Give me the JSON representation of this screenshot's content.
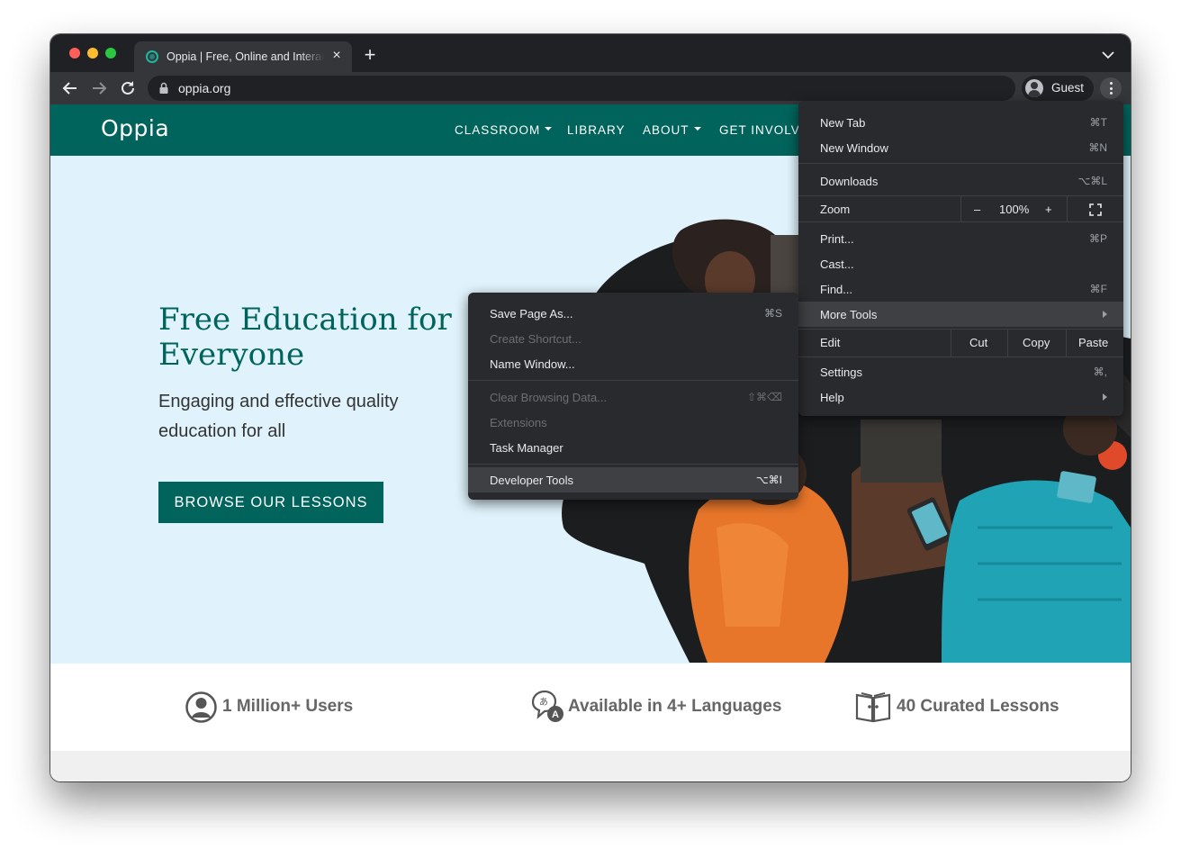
{
  "browser": {
    "tab_title": "Oppia | Free, Online and Interactive Lessons for Anyone",
    "tab_close": "×",
    "new_tab": "+",
    "url": "oppia.org",
    "profile": "Guest"
  },
  "site": {
    "logo": "Oppia",
    "nav": [
      "CLASSROOM",
      "LIBRARY",
      "ABOUT",
      "GET INVOLVED"
    ],
    "hero_title": "Free Education for Everyone",
    "hero_subtitle": "Engaging and effective quality education for all",
    "cta": "BROWSE OUR LESSONS",
    "stats": [
      "1 Million+ Users",
      "Available in 4+ Languages",
      "40 Curated Lessons"
    ],
    "brand_color": "#00645c",
    "hero_bg": "#e0f3fc"
  },
  "chrome_menu": {
    "new_tab": {
      "label": "New Tab",
      "shortcut": "⌘T"
    },
    "new_window": {
      "label": "New Window",
      "shortcut": "⌘N"
    },
    "downloads": {
      "label": "Downloads",
      "shortcut": "⌥⌘L"
    },
    "zoom": {
      "label": "Zoom",
      "minus": "–",
      "level": "100%",
      "plus": "+"
    },
    "print": {
      "label": "Print...",
      "shortcut": "⌘P"
    },
    "cast": {
      "label": "Cast..."
    },
    "find": {
      "label": "Find...",
      "shortcut": "⌘F"
    },
    "more_tools": {
      "label": "More Tools"
    },
    "edit": {
      "label": "Edit",
      "cut": "Cut",
      "copy": "Copy",
      "paste": "Paste"
    },
    "settings": {
      "label": "Settings",
      "shortcut": "⌘,"
    },
    "help": {
      "label": "Help"
    }
  },
  "more_tools_menu": {
    "save_page": {
      "label": "Save Page As...",
      "shortcut": "⌘S"
    },
    "create_shortcut": {
      "label": "Create Shortcut..."
    },
    "name_window": {
      "label": "Name Window..."
    },
    "clear_data": {
      "label": "Clear Browsing Data...",
      "shortcut": "⇧⌘⌫"
    },
    "extensions": {
      "label": "Extensions"
    },
    "task_manager": {
      "label": "Task Manager"
    },
    "dev_tools": {
      "label": "Developer Tools",
      "shortcut": "⌥⌘I"
    }
  }
}
